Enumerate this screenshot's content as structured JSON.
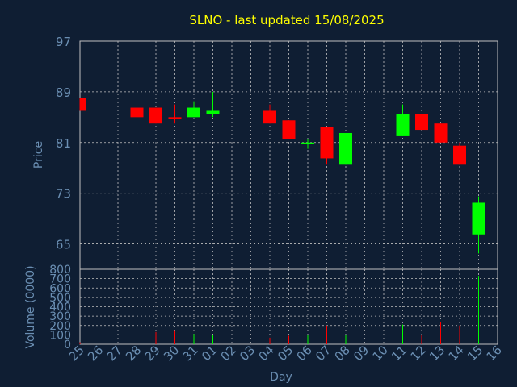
{
  "colors": {
    "background": "#0f1e33",
    "plot_border": "#c0c0c0",
    "grid": "#c0c0c0",
    "axis_text": "#6b8fb3",
    "title": "#ffff00",
    "bull": "#00ff00",
    "bear": "#ff0000",
    "flat": "#00ff00"
  },
  "chart_data": [
    {
      "type": "candlestick",
      "title": "SLNO - last updated 15/08/2025",
      "ylabel": "Price",
      "ylim": [
        61,
        97
      ],
      "yticks": [
        "97",
        "89",
        "81",
        "73",
        "65"
      ],
      "grid": true,
      "categories": [
        "25",
        "26",
        "27",
        "28",
        "29",
        "30",
        "31",
        "01",
        "02",
        "03",
        "04",
        "05",
        "06",
        "07",
        "08",
        "09",
        "10",
        "11",
        "12",
        "13",
        "14",
        "15",
        "16"
      ],
      "candles": [
        {
          "x": "25",
          "open": 88.0,
          "high": 88.0,
          "low": 86.0,
          "close": 86.0
        },
        {
          "x": "28",
          "open": 86.5,
          "high": 87.5,
          "low": 85.0,
          "close": 85.0
        },
        {
          "x": "29",
          "open": 86.5,
          "high": 86.5,
          "low": 84.0,
          "close": 84.0
        },
        {
          "x": "30",
          "open": 85.0,
          "high": 87.0,
          "low": 84.0,
          "close": 84.8
        },
        {
          "x": "31",
          "open": 85.0,
          "high": 87.5,
          "low": 85.0,
          "close": 86.5
        },
        {
          "x": "01",
          "open": 85.5,
          "high": 89.0,
          "low": 85.0,
          "close": 86.0
        },
        {
          "x": "04",
          "open": 86.0,
          "high": 87.0,
          "low": 84.0,
          "close": 84.0
        },
        {
          "x": "05",
          "open": 84.5,
          "high": 84.5,
          "low": 81.5,
          "close": 81.5
        },
        {
          "x": "06",
          "open": 81.0,
          "high": 81.5,
          "low": 80.0,
          "close": 81.0
        },
        {
          "x": "07",
          "open": 83.5,
          "high": 83.5,
          "low": 77.5,
          "close": 78.5
        },
        {
          "x": "08",
          "open": 77.5,
          "high": 82.5,
          "low": 77.5,
          "close": 82.5
        },
        {
          "x": "11",
          "open": 82.0,
          "high": 87.0,
          "low": 82.0,
          "close": 85.5
        },
        {
          "x": "12",
          "open": 85.5,
          "high": 85.5,
          "low": 83.0,
          "close": 83.0
        },
        {
          "x": "13",
          "open": 84.0,
          "high": 84.0,
          "low": 81.0,
          "close": 81.0
        },
        {
          "x": "14",
          "open": 80.5,
          "high": 81.0,
          "low": 77.5,
          "close": 77.5
        },
        {
          "x": "15",
          "open": 66.5,
          "high": 72.5,
          "low": 63.5,
          "close": 71.5
        }
      ]
    },
    {
      "type": "bar",
      "ylabel": "Volume (0000)",
      "xlabel": "Day",
      "ylim": [
        0,
        800
      ],
      "yticks": [
        "800",
        "700",
        "600",
        "500",
        "400",
        "300",
        "200",
        "100",
        "0"
      ],
      "grid": true,
      "categories": [
        "25",
        "26",
        "27",
        "28",
        "29",
        "30",
        "31",
        "01",
        "02",
        "03",
        "04",
        "05",
        "06",
        "07",
        "08",
        "09",
        "10",
        "11",
        "12",
        "13",
        "14",
        "15",
        "16"
      ],
      "bars": [
        {
          "x": "25",
          "value": 20,
          "dir": "down"
        },
        {
          "x": "28",
          "value": 100,
          "dir": "down"
        },
        {
          "x": "29",
          "value": 130,
          "dir": "down"
        },
        {
          "x": "30",
          "value": 150,
          "dir": "down"
        },
        {
          "x": "31",
          "value": 110,
          "dir": "up"
        },
        {
          "x": "01",
          "value": 100,
          "dir": "up"
        },
        {
          "x": "04",
          "value": 70,
          "dir": "down"
        },
        {
          "x": "05",
          "value": 90,
          "dir": "down"
        },
        {
          "x": "06",
          "value": 100,
          "dir": "flat"
        },
        {
          "x": "07",
          "value": 200,
          "dir": "down"
        },
        {
          "x": "08",
          "value": 100,
          "dir": "up"
        },
        {
          "x": "11",
          "value": 210,
          "dir": "up"
        },
        {
          "x": "12",
          "value": 100,
          "dir": "down"
        },
        {
          "x": "13",
          "value": 240,
          "dir": "down"
        },
        {
          "x": "14",
          "value": 200,
          "dir": "down"
        },
        {
          "x": "15",
          "value": 730,
          "dir": "up"
        }
      ]
    }
  ]
}
